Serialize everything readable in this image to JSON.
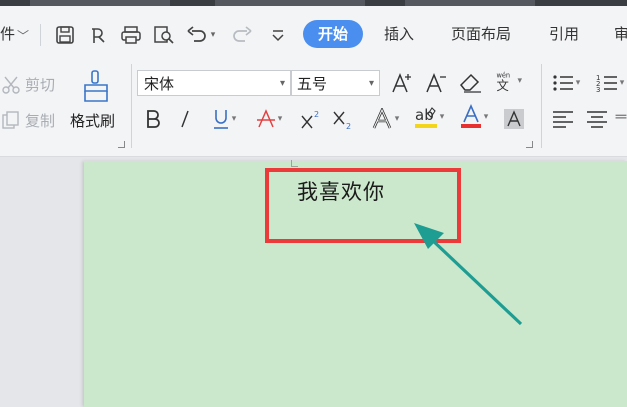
{
  "menu": {
    "file_label": "件"
  },
  "tabs": {
    "home": "开始",
    "insert": "插入",
    "layout": "页面布局",
    "references": "引用",
    "review": "审"
  },
  "clipboard": {
    "cut": "剪切",
    "copy": "复制",
    "painter": "格式刷"
  },
  "font": {
    "family": "宋体",
    "size": "五号"
  },
  "document": {
    "text": "我喜欢你"
  },
  "icons": [
    "save-icon",
    "pdf-export-icon",
    "print-icon",
    "print-preview-icon",
    "undo-icon",
    "redo-icon",
    "customize-icon",
    "cut-icon",
    "copy-icon",
    "format-painter-icon",
    "grow-font-icon",
    "shrink-font-icon",
    "clear-format-icon",
    "phonetic-guide-icon",
    "bold-icon",
    "italic-icon",
    "underline-icon",
    "strikethrough-icon",
    "superscript-icon",
    "subscript-icon",
    "text-effect-icon",
    "highlight-icon",
    "font-color-icon",
    "char-shading-icon",
    "bullets-icon",
    "numbering-icon",
    "align-left-icon",
    "align-center-icon"
  ],
  "colors": {
    "accent": "#4a8ff0",
    "highlight_box": "#ec3a3a",
    "arrow": "#1e9d93",
    "page": "#cce8cc",
    "highlight_bar": "#f3d61c",
    "font_color_bar": "#e83030"
  }
}
